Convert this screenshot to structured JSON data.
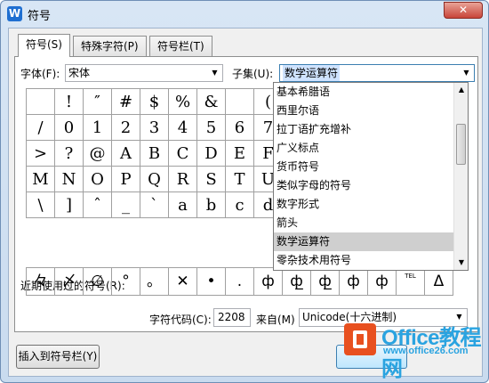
{
  "window": {
    "title": "符号",
    "icon_label": "W",
    "close_label": "✕"
  },
  "tabs": [
    {
      "label": "符号(S)",
      "active": true
    },
    {
      "label": "特殊字符(P)",
      "active": false
    },
    {
      "label": "符号栏(T)",
      "active": false
    }
  ],
  "font": {
    "label": "字体(F):",
    "value": "宋体"
  },
  "subset": {
    "label": "子集(U):",
    "value": "数学运算符",
    "options": [
      "基本希腊语",
      "西里尔语",
      "拉丁语扩充增补",
      "广义标点",
      "货币符号",
      "类似字母的符号",
      "数字形式",
      "箭头",
      "数学运算符",
      "零杂技术用符号"
    ],
    "selected_index": 8
  },
  "symbol_grid": [
    [
      "",
      "!",
      "″",
      "#",
      "$",
      "%",
      "&",
      "",
      "("
    ],
    [
      "/",
      "0",
      "1",
      "2",
      "3",
      "4",
      "5",
      "6",
      "7"
    ],
    [
      ">",
      "?",
      "@",
      "A",
      "B",
      "C",
      "D",
      "E",
      "F"
    ],
    [
      "M",
      "N",
      "O",
      "P",
      "Q",
      "R",
      "S",
      "T",
      "U"
    ],
    [
      "\\",
      "]",
      "ˆ",
      "_",
      "`",
      "a",
      "b",
      "c",
      "d"
    ]
  ],
  "recent": {
    "label": "近期使用过的符号(R):",
    "symbols": [
      "々",
      "〆",
      "∅",
      "°",
      "。",
      "✕",
      "•",
      ".",
      "ф",
      "ф̲",
      "ф̲",
      "ф",
      "ф",
      "TEL",
      "Δ"
    ]
  },
  "char_code": {
    "label": "字符代码(C):",
    "value": "2208"
  },
  "from": {
    "label": "来自(M)",
    "value": "Unicode(十六进制)"
  },
  "buttons": {
    "insert_to_bar": "插入到符号栏(Y)"
  },
  "watermark": {
    "brand": "Office教程网",
    "url": "www.office26.com"
  }
}
